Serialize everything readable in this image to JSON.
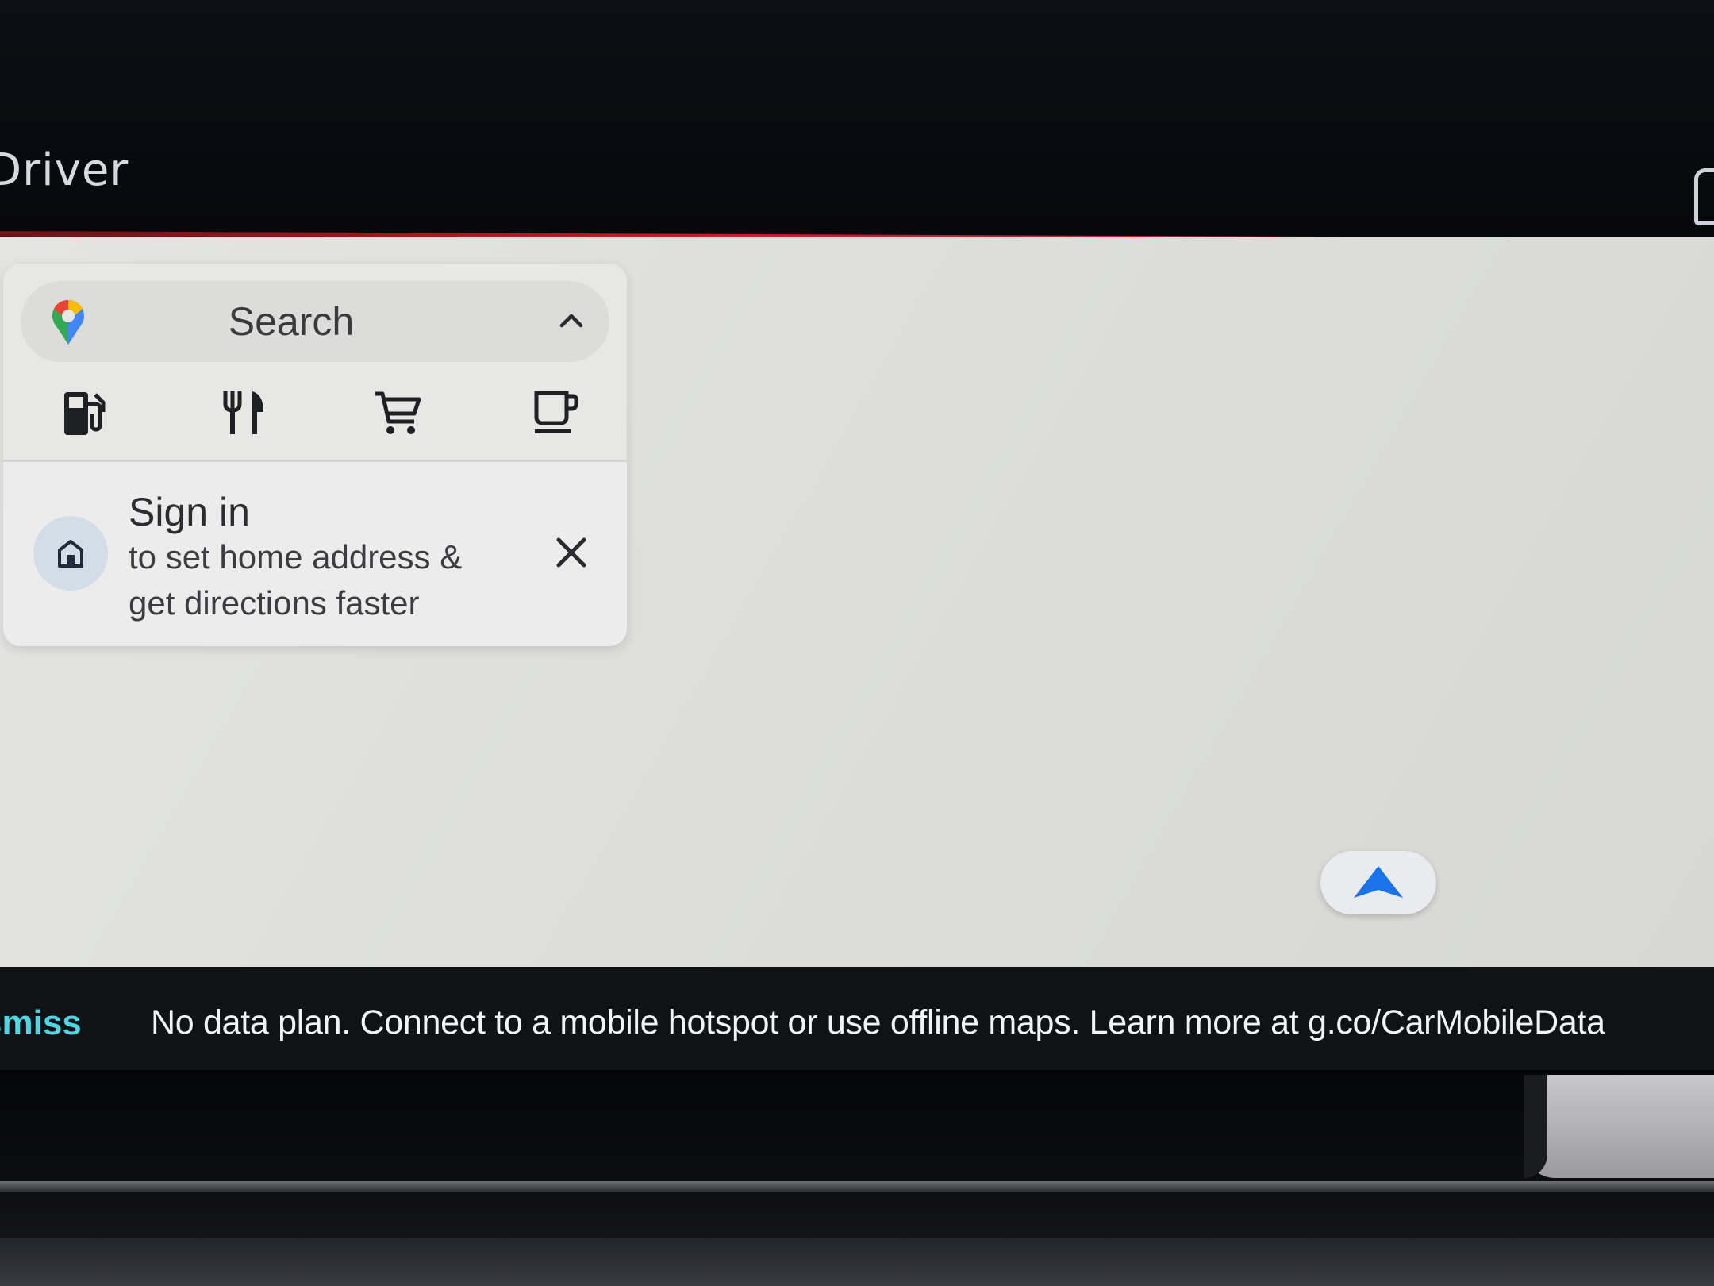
{
  "header": {
    "profile_label": "Driver"
  },
  "search_card": {
    "search_label": "Search",
    "categories": [
      {
        "name": "gas-station",
        "icon": "gas-station-icon"
      },
      {
        "name": "restaurants",
        "icon": "restaurant-icon"
      },
      {
        "name": "grocery",
        "icon": "shopping-cart-icon"
      },
      {
        "name": "coffee",
        "icon": "coffee-icon"
      }
    ],
    "signin": {
      "title": "Sign in",
      "line1": "to set home address &",
      "line2": "get directions faster"
    }
  },
  "banner": {
    "dismiss_label": "smiss",
    "message": "No data plan. Connect to a mobile hotspot or use offline maps. Learn more at g.co/CarMobileData"
  },
  "colors": {
    "accent_line": "#d71a22",
    "dismiss_text": "#4fd6e0",
    "nav_arrow": "#1a73e8",
    "map_background": "#dedfdb"
  }
}
